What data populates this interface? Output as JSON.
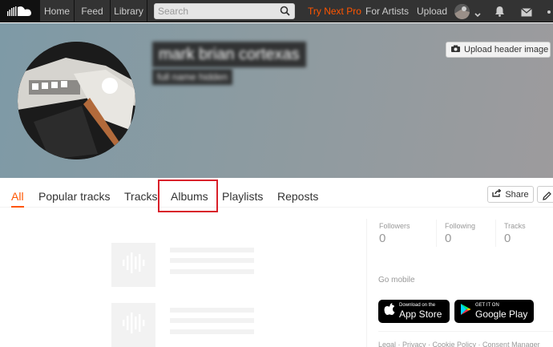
{
  "nav": {
    "home": "Home",
    "feed": "Feed",
    "library": "Library",
    "search_placeholder": "Search",
    "try_next_pro": "Try Next Pro",
    "for_artists": "For Artists",
    "upload": "Upload"
  },
  "profile": {
    "name": "mark brian cortexas",
    "subtitle": "full name hidden",
    "upload_header_label": "Upload header image"
  },
  "tabs": [
    {
      "label": "All",
      "active": true
    },
    {
      "label": "Popular tracks"
    },
    {
      "label": "Tracks"
    },
    {
      "label": "Albums",
      "highlighted": true
    },
    {
      "label": "Playlists"
    },
    {
      "label": "Reposts"
    }
  ],
  "actions": {
    "share": "Share"
  },
  "stats": [
    {
      "label": "Followers",
      "value": "0"
    },
    {
      "label": "Following",
      "value": "0"
    },
    {
      "label": "Tracks",
      "value": "0"
    }
  ],
  "sidebar": {
    "go_mobile": "Go mobile",
    "app_store_small": "Download on the",
    "app_store_big": "App Store",
    "google_play_small": "GET IT ON",
    "google_play_big": "Google Play",
    "footer": "Legal · Privacy · Cookie Policy · Consent Manager"
  },
  "colors": {
    "accent": "#ff5500",
    "topbar": "#333333",
    "highlight": "#d9202a"
  }
}
